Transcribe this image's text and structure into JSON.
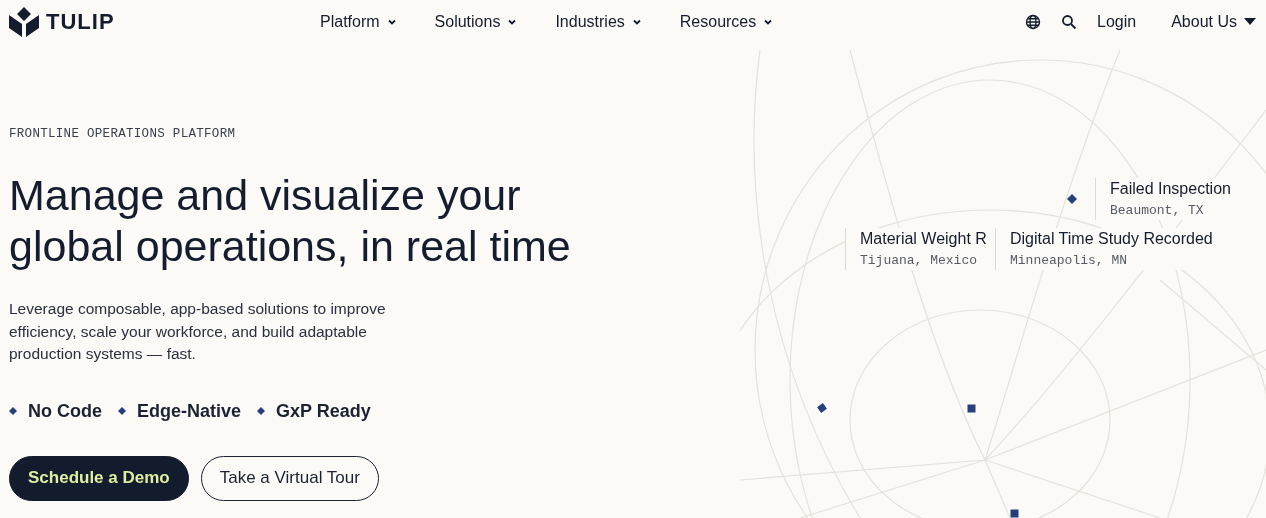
{
  "brand": {
    "name": "TULIP"
  },
  "nav": {
    "menus": [
      {
        "label": "Platform"
      },
      {
        "label": "Solutions"
      },
      {
        "label": "Industries"
      },
      {
        "label": "Resources"
      }
    ],
    "login": "Login",
    "about": "About Us"
  },
  "hero": {
    "eyebrow": "FRONTLINE OPERATIONS PLATFORM",
    "headline": "Manage and visualize your global operations, in real time",
    "description": "Leverage composable, app-based solutions to improve efficiency, scale your workforce, and build adaptable production systems — fast.",
    "features": [
      "No Code",
      "Edge-Native",
      "GxP Ready"
    ],
    "buttons": [
      {
        "label": "Schedule a Demo",
        "kind": "primary"
      },
      {
        "label": "Take a Virtual Tour",
        "kind": "secondary"
      }
    ]
  },
  "events": [
    {
      "title": "Failed Inspection",
      "location": "Beaumont, TX"
    },
    {
      "title": "Material Weight R",
      "location": "Tijuana, Mexico"
    },
    {
      "title": "Digital Time Study Recorded",
      "location": "Minneapolis, MN"
    }
  ]
}
